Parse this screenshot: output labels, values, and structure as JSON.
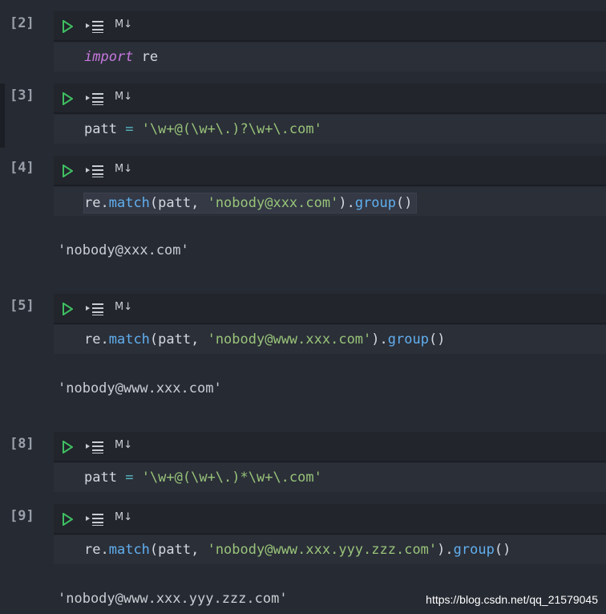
{
  "toolbar": {
    "md_label": "M↓"
  },
  "cells": [
    {
      "count": "[2]",
      "tokens": [
        {
          "t": "import",
          "c": "kw"
        },
        {
          "t": " re",
          "c": "plain"
        }
      ],
      "output": null
    },
    {
      "count": "[3]",
      "tokens": [
        {
          "t": "patt ",
          "c": "plain"
        },
        {
          "t": "=",
          "c": "op"
        },
        {
          "t": " ",
          "c": "plain"
        },
        {
          "t": "'\\w+@(\\w+\\.)?\\w+\\.com'",
          "c": "str"
        }
      ],
      "output": null
    },
    {
      "count": "[4]",
      "tokens": [
        {
          "t": "re",
          "c": "plain"
        },
        {
          "t": ".",
          "c": "plain"
        },
        {
          "t": "match",
          "c": "fn"
        },
        {
          "t": "(patt, ",
          "c": "plain"
        },
        {
          "t": "'nobody@xxx.com'",
          "c": "str"
        },
        {
          "t": ").",
          "c": "plain"
        },
        {
          "t": "group",
          "c": "fn"
        },
        {
          "t": "()",
          "c": "plain"
        }
      ],
      "output": "'nobody@xxx.com'"
    },
    {
      "count": "[5]",
      "tokens": [
        {
          "t": "re",
          "c": "plain"
        },
        {
          "t": ".",
          "c": "plain"
        },
        {
          "t": "match",
          "c": "fn"
        },
        {
          "t": "(patt, ",
          "c": "plain"
        },
        {
          "t": "'nobody@www.xxx.com'",
          "c": "str"
        },
        {
          "t": ").",
          "c": "plain"
        },
        {
          "t": "group",
          "c": "fn"
        },
        {
          "t": "()",
          "c": "plain"
        }
      ],
      "output": "'nobody@www.xxx.com'"
    },
    {
      "count": "[8]",
      "tokens": [
        {
          "t": "patt ",
          "c": "plain"
        },
        {
          "t": "=",
          "c": "op"
        },
        {
          "t": " ",
          "c": "plain"
        },
        {
          "t": "'\\w+@(\\w+\\.)*\\w+\\.com'",
          "c": "str"
        }
      ],
      "output": null
    },
    {
      "count": "[9]",
      "tokens": [
        {
          "t": "re",
          "c": "plain"
        },
        {
          "t": ".",
          "c": "plain"
        },
        {
          "t": "match",
          "c": "fn"
        },
        {
          "t": "(patt, ",
          "c": "plain"
        },
        {
          "t": "'nobody@www.xxx.yyy.zzz.com'",
          "c": "str"
        },
        {
          "t": ").",
          "c": "plain"
        },
        {
          "t": "group",
          "c": "fn"
        },
        {
          "t": "()",
          "c": "plain"
        }
      ],
      "output": "'nobody@www.xxx.yyy.zzz.com'"
    }
  ],
  "watermark": "https://blog.csdn.net/qq_21579045"
}
